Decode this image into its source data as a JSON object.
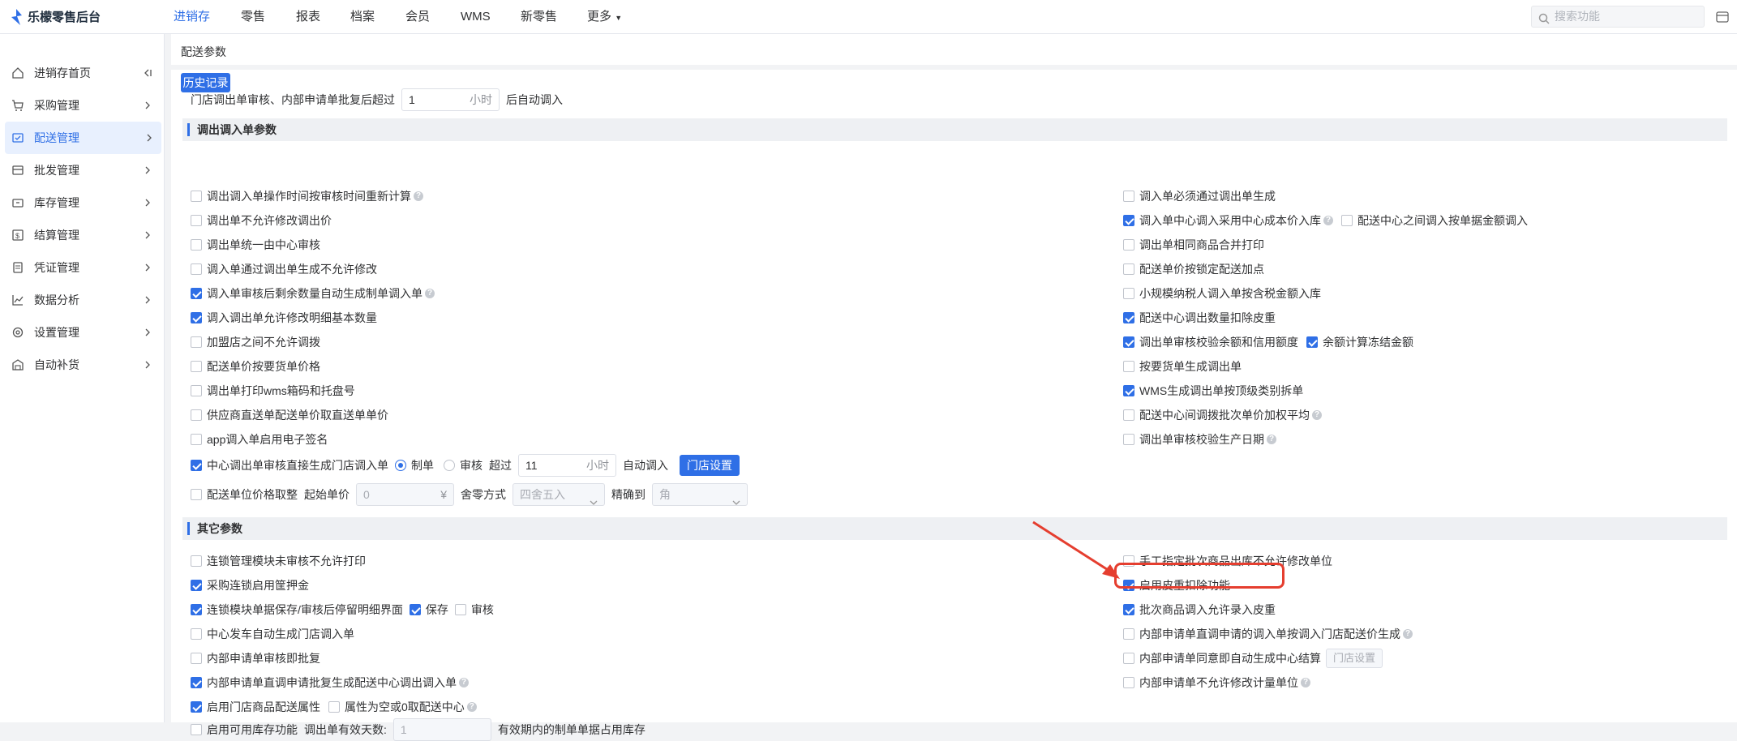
{
  "app": {
    "title": "乐檬零售后台"
  },
  "topnav": [
    "进销存",
    "零售",
    "报表",
    "档案",
    "会员",
    "WMS",
    "新零售",
    "更多"
  ],
  "search": {
    "placeholder": "搜索功能"
  },
  "sidebar": [
    {
      "label": "进销存首页",
      "icon": "home-icon"
    },
    {
      "label": "采购管理",
      "icon": "cart-icon"
    },
    {
      "label": "配送管理",
      "icon": "delivery-icon"
    },
    {
      "label": "批发管理",
      "icon": "wholesale-icon"
    },
    {
      "label": "库存管理",
      "icon": "inventory-icon"
    },
    {
      "label": "结算管理",
      "icon": "settlement-icon"
    },
    {
      "label": "凭证管理",
      "icon": "voucher-icon"
    },
    {
      "label": "数据分析",
      "icon": "chart-icon"
    },
    {
      "label": "设置管理",
      "icon": "settings-icon"
    },
    {
      "label": "自动补货",
      "icon": "restock-icon"
    }
  ],
  "tab": "配送参数",
  "history_button": "历史记录",
  "auto_row": {
    "prefix": "门店调出单审核、内部申请单批复后超过",
    "value": "1",
    "unit": "小时",
    "suffix": "后自动调入"
  },
  "section1": "调出调入单参数",
  "left1": [
    "调出调入单操作时间按审核时间重新计算",
    "调出单不允许修改调出价",
    "调出单统一由中心审核",
    "调入单通过调出单生成不允许修改",
    "调入单审核后剩余数量自动生成制单调入单",
    "调入调出单允许修改明细基本数量",
    "加盟店之间不允许调拨",
    "配送单价按要货单价格",
    "调出单打印wms箱码和托盘号",
    "供应商直送单配送单价取直送单单价",
    "app调入单启用电子签名"
  ],
  "center_row": {
    "label": "中心调出单审核直接生成门店调入单",
    "opt1": "制单",
    "opt2": "审核",
    "over": "超过",
    "value": "11",
    "unit": "小时",
    "suffix": "自动调入",
    "btn": "门店设置"
  },
  "price_row": {
    "label": "配送单位价格取整",
    "start": "起始单价",
    "value": "0",
    "unit": "¥",
    "rounding_label": "舍零方式",
    "rounding": "四舍五入",
    "precision_label": "精确到",
    "precision": "角"
  },
  "right1": [
    "调入单必须通过调出单生成",
    "调入单中心调入采用中心成本价入库",
    "配送中心之间调入按单据金额调入",
    "调出单相同商品合并打印",
    "配送单价按锁定配送加点",
    "小规模纳税人调入单按含税金额入库",
    "配送中心调出数量扣除皮重",
    "调出单审核校验余额和信用额度",
    "余额计算冻结金额",
    "按要货单生成调出单",
    "WMS生成调出单按顶级类别拆单",
    "配送中心间调拨批次单价加权平均",
    "调出单审核校验生产日期"
  ],
  "section2": "其它参数",
  "left2": [
    "连锁管理模块未审核不允许打印",
    "采购连锁启用筐押金",
    "连锁模块单据保存/审核后停留明细界面",
    "保存",
    "审核",
    "中心发车自动生成门店调入单",
    "内部申请单审核即批复",
    "内部申请单直调申请批复生成配送中心调出调入单",
    "启用门店商品配送属性",
    "属性为空或0取配送中心",
    "启用可用库存功能",
    "调出单有效天数:",
    "1",
    "有效期内的制单单据占用库存"
  ],
  "right2": [
    "手工指定批次商品出库不允许修改单位",
    "启用皮重扣除功能",
    "批次商品调入允许录入皮重",
    "内部申请单直调申请的调入单按调入门店配送价生成",
    "内部申请单同意即自动生成中心结算",
    "门店设置",
    "内部申请单不允许修改计量单位"
  ]
}
